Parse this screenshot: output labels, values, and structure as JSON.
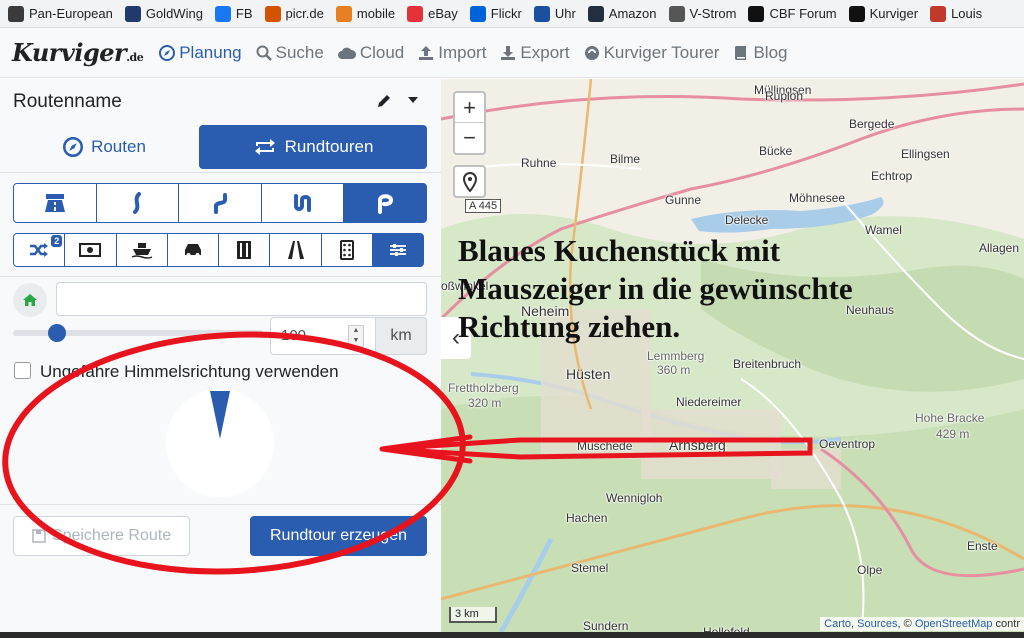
{
  "bookmarks": [
    {
      "label": "Pan-European",
      "color": "#3b3b3b"
    },
    {
      "label": "GoldWing",
      "color": "#1f3a6b"
    },
    {
      "label": "FB",
      "color": "#1877f2"
    },
    {
      "label": "picr.de",
      "color": "#d35400"
    },
    {
      "label": "mobile",
      "color": "#e67e22"
    },
    {
      "label": "eBay",
      "color": "#e53238"
    },
    {
      "label": "Flickr",
      "color": "#0063dc"
    },
    {
      "label": "Uhr",
      "color": "#1b4fa0"
    },
    {
      "label": "Amazon",
      "color": "#232f3e"
    },
    {
      "label": "V-Strom",
      "color": "#555"
    },
    {
      "label": "CBF Forum",
      "color": "#111"
    },
    {
      "label": "Kurviger",
      "color": "#111"
    },
    {
      "label": "Louis",
      "color": "#c0392b"
    }
  ],
  "navbar": {
    "logo": "Kurviger",
    "logo_suffix": ".de",
    "items": [
      {
        "label": "Planung",
        "icon": "compass-icon",
        "active": true
      },
      {
        "label": "Suche",
        "icon": "search-icon"
      },
      {
        "label": "Cloud",
        "icon": "cloud-icon"
      },
      {
        "label": "Import",
        "icon": "upload-icon"
      },
      {
        "label": "Export",
        "icon": "download-icon"
      },
      {
        "label": "Kurviger Tourer",
        "icon": "tourer-icon"
      },
      {
        "label": "Blog",
        "icon": "book-icon"
      }
    ]
  },
  "sidebar": {
    "route_name": "Routenname",
    "tab_routes": "Routen",
    "tab_roundtrip": "Rundtouren",
    "curviness_icons": [
      "highway-icon",
      "curve-1-icon",
      "curve-2-icon",
      "curve-3-icon",
      "curve-4-icon"
    ],
    "curviness_selected": 4,
    "options_icons": [
      "shuffle-icon",
      "money-icon",
      "ferry-icon",
      "car-icon",
      "toll-icon",
      "road-icon",
      "dice-icon",
      "sliders-icon"
    ],
    "shuffle_badge": "2",
    "address_value": "",
    "distance_value": "100",
    "distance_unit": "km",
    "slider_fraction": 0.15,
    "direction_label": "Ungefähre Himmelsrichtung verwenden",
    "save_label": "Speichere Route",
    "generate_label": "Rundtour erzeugen"
  },
  "map": {
    "overlay_text": [
      "Blaues Kuchenstück mit",
      "Mauszeiger in die gewünschte",
      "Richtung ziehen."
    ],
    "zoom_in": "+",
    "zoom_out": "−",
    "collapse": "‹",
    "scale": "3 km",
    "attribution": {
      "carto": "Carto",
      "sources": "Sources",
      "sep": ", ©",
      "osm": "OpenStreetMap",
      "rest": "contr"
    },
    "labels": [
      {
        "text": "Müllingsen"
      },
      {
        "text": "Ruploh"
      },
      {
        "text": "Bergede"
      },
      {
        "text": "Bilme"
      },
      {
        "text": "Bücke"
      },
      {
        "text": "Ellingsen"
      },
      {
        "text": "Ruhne"
      },
      {
        "text": "Echtrop"
      },
      {
        "text": "Gunne"
      },
      {
        "text": "Möhnesee"
      },
      {
        "text": "Delecke"
      },
      {
        "text": "Wamel"
      },
      {
        "text": "A 445"
      },
      {
        "text": "Allagen"
      },
      {
        "text": "oßwinkel"
      },
      {
        "text": "Neuhaus"
      },
      {
        "text": "Neheim"
      },
      {
        "text": "Lemmberg"
      },
      {
        "text": "360 m"
      },
      {
        "text": "Hüsten"
      },
      {
        "text": "Breitenbruch"
      },
      {
        "text": "Frettholzberg"
      },
      {
        "text": "320 m"
      },
      {
        "text": "Niedereimer"
      },
      {
        "text": "Hohe Bracke"
      },
      {
        "text": "429 m"
      },
      {
        "text": "Müschede"
      },
      {
        "text": "Arnsberg"
      },
      {
        "text": "Oeventrop"
      },
      {
        "text": "Wennigloh"
      },
      {
        "text": "Hachen"
      },
      {
        "text": "Enste"
      },
      {
        "text": "Stemel"
      },
      {
        "text": "Olpe"
      },
      {
        "text": "Sundern"
      },
      {
        "text": "Hellefeld"
      }
    ]
  }
}
